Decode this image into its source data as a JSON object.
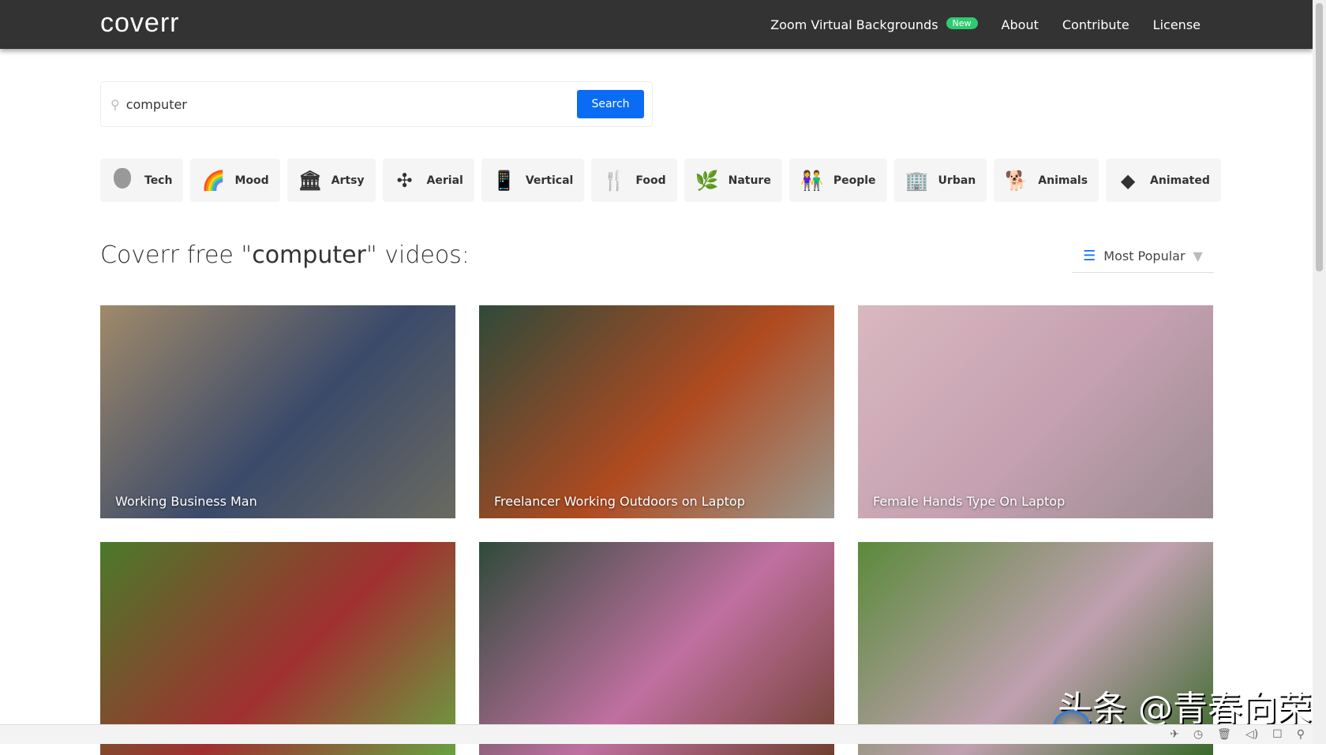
{
  "header": {
    "logo": "coverr",
    "nav": [
      {
        "label": "Zoom Virtual Backgrounds",
        "badge": "New"
      },
      {
        "label": "About"
      },
      {
        "label": "Contribute"
      },
      {
        "label": "License"
      }
    ]
  },
  "search": {
    "value": "computer",
    "button": "Search",
    "icon": "search-icon"
  },
  "categories": [
    {
      "label": "Tech",
      "icon": ""
    },
    {
      "label": "Mood",
      "icon": "🌈"
    },
    {
      "label": "Artsy",
      "icon": "🏛"
    },
    {
      "label": "Aerial",
      "icon": "✣"
    },
    {
      "label": "Vertical",
      "icon": "📱"
    },
    {
      "label": "Food",
      "icon": "🍴"
    },
    {
      "label": "Nature",
      "icon": "🌿"
    },
    {
      "label": "People",
      "icon": "👫"
    },
    {
      "label": "Urban",
      "icon": "🏢"
    },
    {
      "label": "Animals",
      "icon": "🐕"
    },
    {
      "label": "Animated",
      "icon": "◆"
    }
  ],
  "heading": {
    "prefix": "Coverr free \"",
    "term": "computer",
    "suffix": "\" videos:"
  },
  "sort": {
    "label": "Most Popular"
  },
  "videos": [
    {
      "title": "Working Business Man",
      "colors": [
        "#a08a6a",
        "#3b4a6a",
        "#6a6a60"
      ]
    },
    {
      "title": "Freelancer Working Outdoors on Laptop",
      "colors": [
        "#2f4a3a",
        "#b04a20",
        "#9a9a90"
      ]
    },
    {
      "title": "Female Hands Type On Laptop",
      "colors": [
        "#d9b8c0",
        "#c4a0b0",
        "#9a8a90"
      ]
    },
    {
      "title": "",
      "colors": [
        "#4a7a2a",
        "#a03030",
        "#6aa040"
      ]
    },
    {
      "title": "",
      "colors": [
        "#2f4a3a",
        "#c070a0",
        "#704030"
      ]
    },
    {
      "title": "",
      "colors": [
        "#5a8a3a",
        "#c0a0b0",
        "#3a6a2a"
      ]
    }
  ],
  "watermark": "头条 @青春向荣",
  "taskbar": [
    "pin-icon",
    "clock-icon",
    "trash-icon",
    "speaker-icon",
    "window-icon",
    "search-icon"
  ]
}
